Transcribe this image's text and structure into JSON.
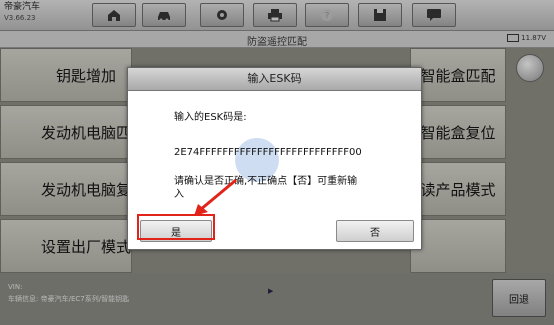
{
  "brand": {
    "name": "帝豪汽车",
    "version": "V3.66.23"
  },
  "toolbar": {
    "icons": [
      "home-icon",
      "car-icon",
      "gear-icon",
      "printer-icon",
      "help-icon",
      "save-icon",
      "chat-icon"
    ]
  },
  "subbar": {
    "title": "防盗遥控匹配",
    "battery": "11.87V"
  },
  "menu": {
    "left": [
      "钥匙增加",
      "发动机电脑匹",
      "发动机电脑复",
      "设置出厂模式"
    ],
    "right": [
      "智能盒匹配",
      "智能盒复位",
      "读产品模式"
    ]
  },
  "footer": {
    "vin_label": "VIN:",
    "vehicle_info": "车辆信息: 帝豪汽车/EC7系列/智能钥匙",
    "back_label": "回退"
  },
  "dialog": {
    "title": "输入ESK码",
    "prompt": "输入的ESK码是:",
    "code": "2E74FFFFFFFFFFFFFFFFFFFFFFFFFF00",
    "confirm_line1": "请确认是否正确,不正确点【否】可重新输",
    "confirm_line2": "入",
    "yes_label": "是",
    "no_label": "否"
  },
  "colors": {
    "highlight": "#e2231a",
    "accent": "#3c78c8"
  }
}
